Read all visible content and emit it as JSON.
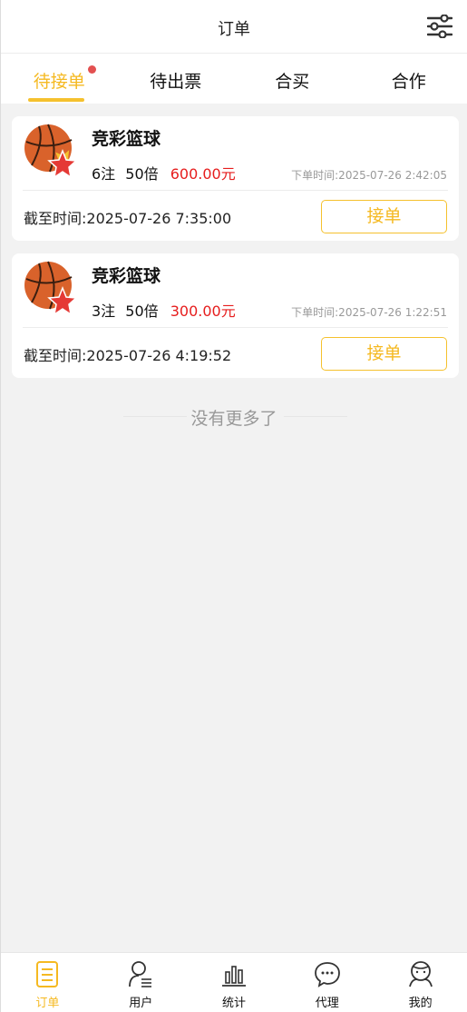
{
  "header": {
    "title": "订单"
  },
  "tabs": [
    {
      "label": "待接单",
      "active": true,
      "has_dot": true
    },
    {
      "label": "待出票"
    },
    {
      "label": "合买"
    },
    {
      "label": "合作"
    }
  ],
  "orders": [
    {
      "lottery_name": "竞彩篮球",
      "bets": "6注",
      "multiplier": "50倍",
      "amount": "600.00元",
      "order_time": "下单时间:2025-07-26 2:42:05",
      "deadline": "截至时间:2025-07-26 7:35:00",
      "action_label": "接单"
    },
    {
      "lottery_name": "竞彩篮球",
      "bets": "3注",
      "multiplier": "50倍",
      "amount": "300.00元",
      "order_time": "下单时间:2025-07-26 1:22:51",
      "deadline": "截至时间:2025-07-26 4:19:52",
      "action_label": "接单"
    }
  ],
  "no_more_text": "没有更多了",
  "bottom_nav": [
    {
      "label": "订单",
      "icon": "order-icon",
      "active": true
    },
    {
      "label": "用户",
      "icon": "user-icon"
    },
    {
      "label": "统计",
      "icon": "stats-icon"
    },
    {
      "label": "代理",
      "icon": "chat-icon"
    },
    {
      "label": "我的",
      "icon": "profile-icon"
    }
  ],
  "colors": {
    "accent": "#f5b921",
    "amount": "#e61d1d",
    "badge": "#e35050"
  }
}
